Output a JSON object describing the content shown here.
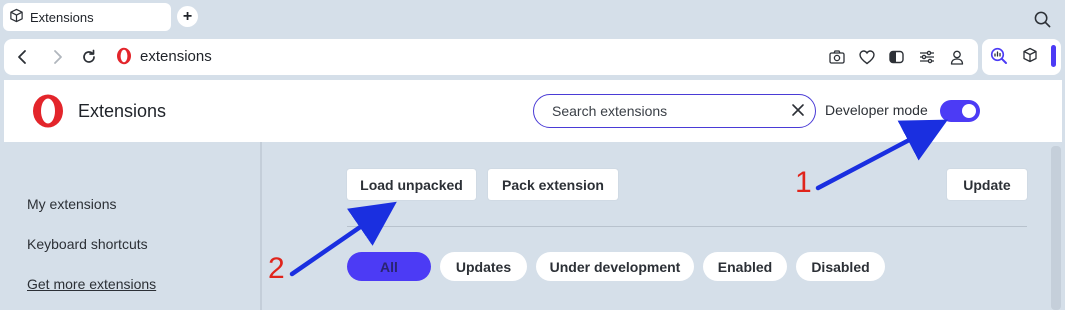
{
  "tab": {
    "title": "Extensions"
  },
  "address": {
    "url": "extensions"
  },
  "header": {
    "title": "Extensions",
    "search_placeholder": "Search extensions",
    "developer_mode_label": "Developer mode",
    "developer_mode_on": true
  },
  "sidebar": {
    "items": [
      {
        "label": "My extensions"
      },
      {
        "label": "Keyboard shortcuts"
      },
      {
        "label": "Get more extensions"
      }
    ]
  },
  "toolbar": {
    "load_unpacked": "Load unpacked",
    "pack_extension": "Pack extension",
    "update": "Update"
  },
  "filters": [
    "All",
    "Updates",
    "Under development",
    "Enabled",
    "Disabled"
  ],
  "annotations": [
    "1",
    "2"
  ],
  "colors": {
    "accent": "#4c3bf5",
    "annotation_arrow": "#1a2fe0",
    "annotation_number": "#e0241b"
  }
}
